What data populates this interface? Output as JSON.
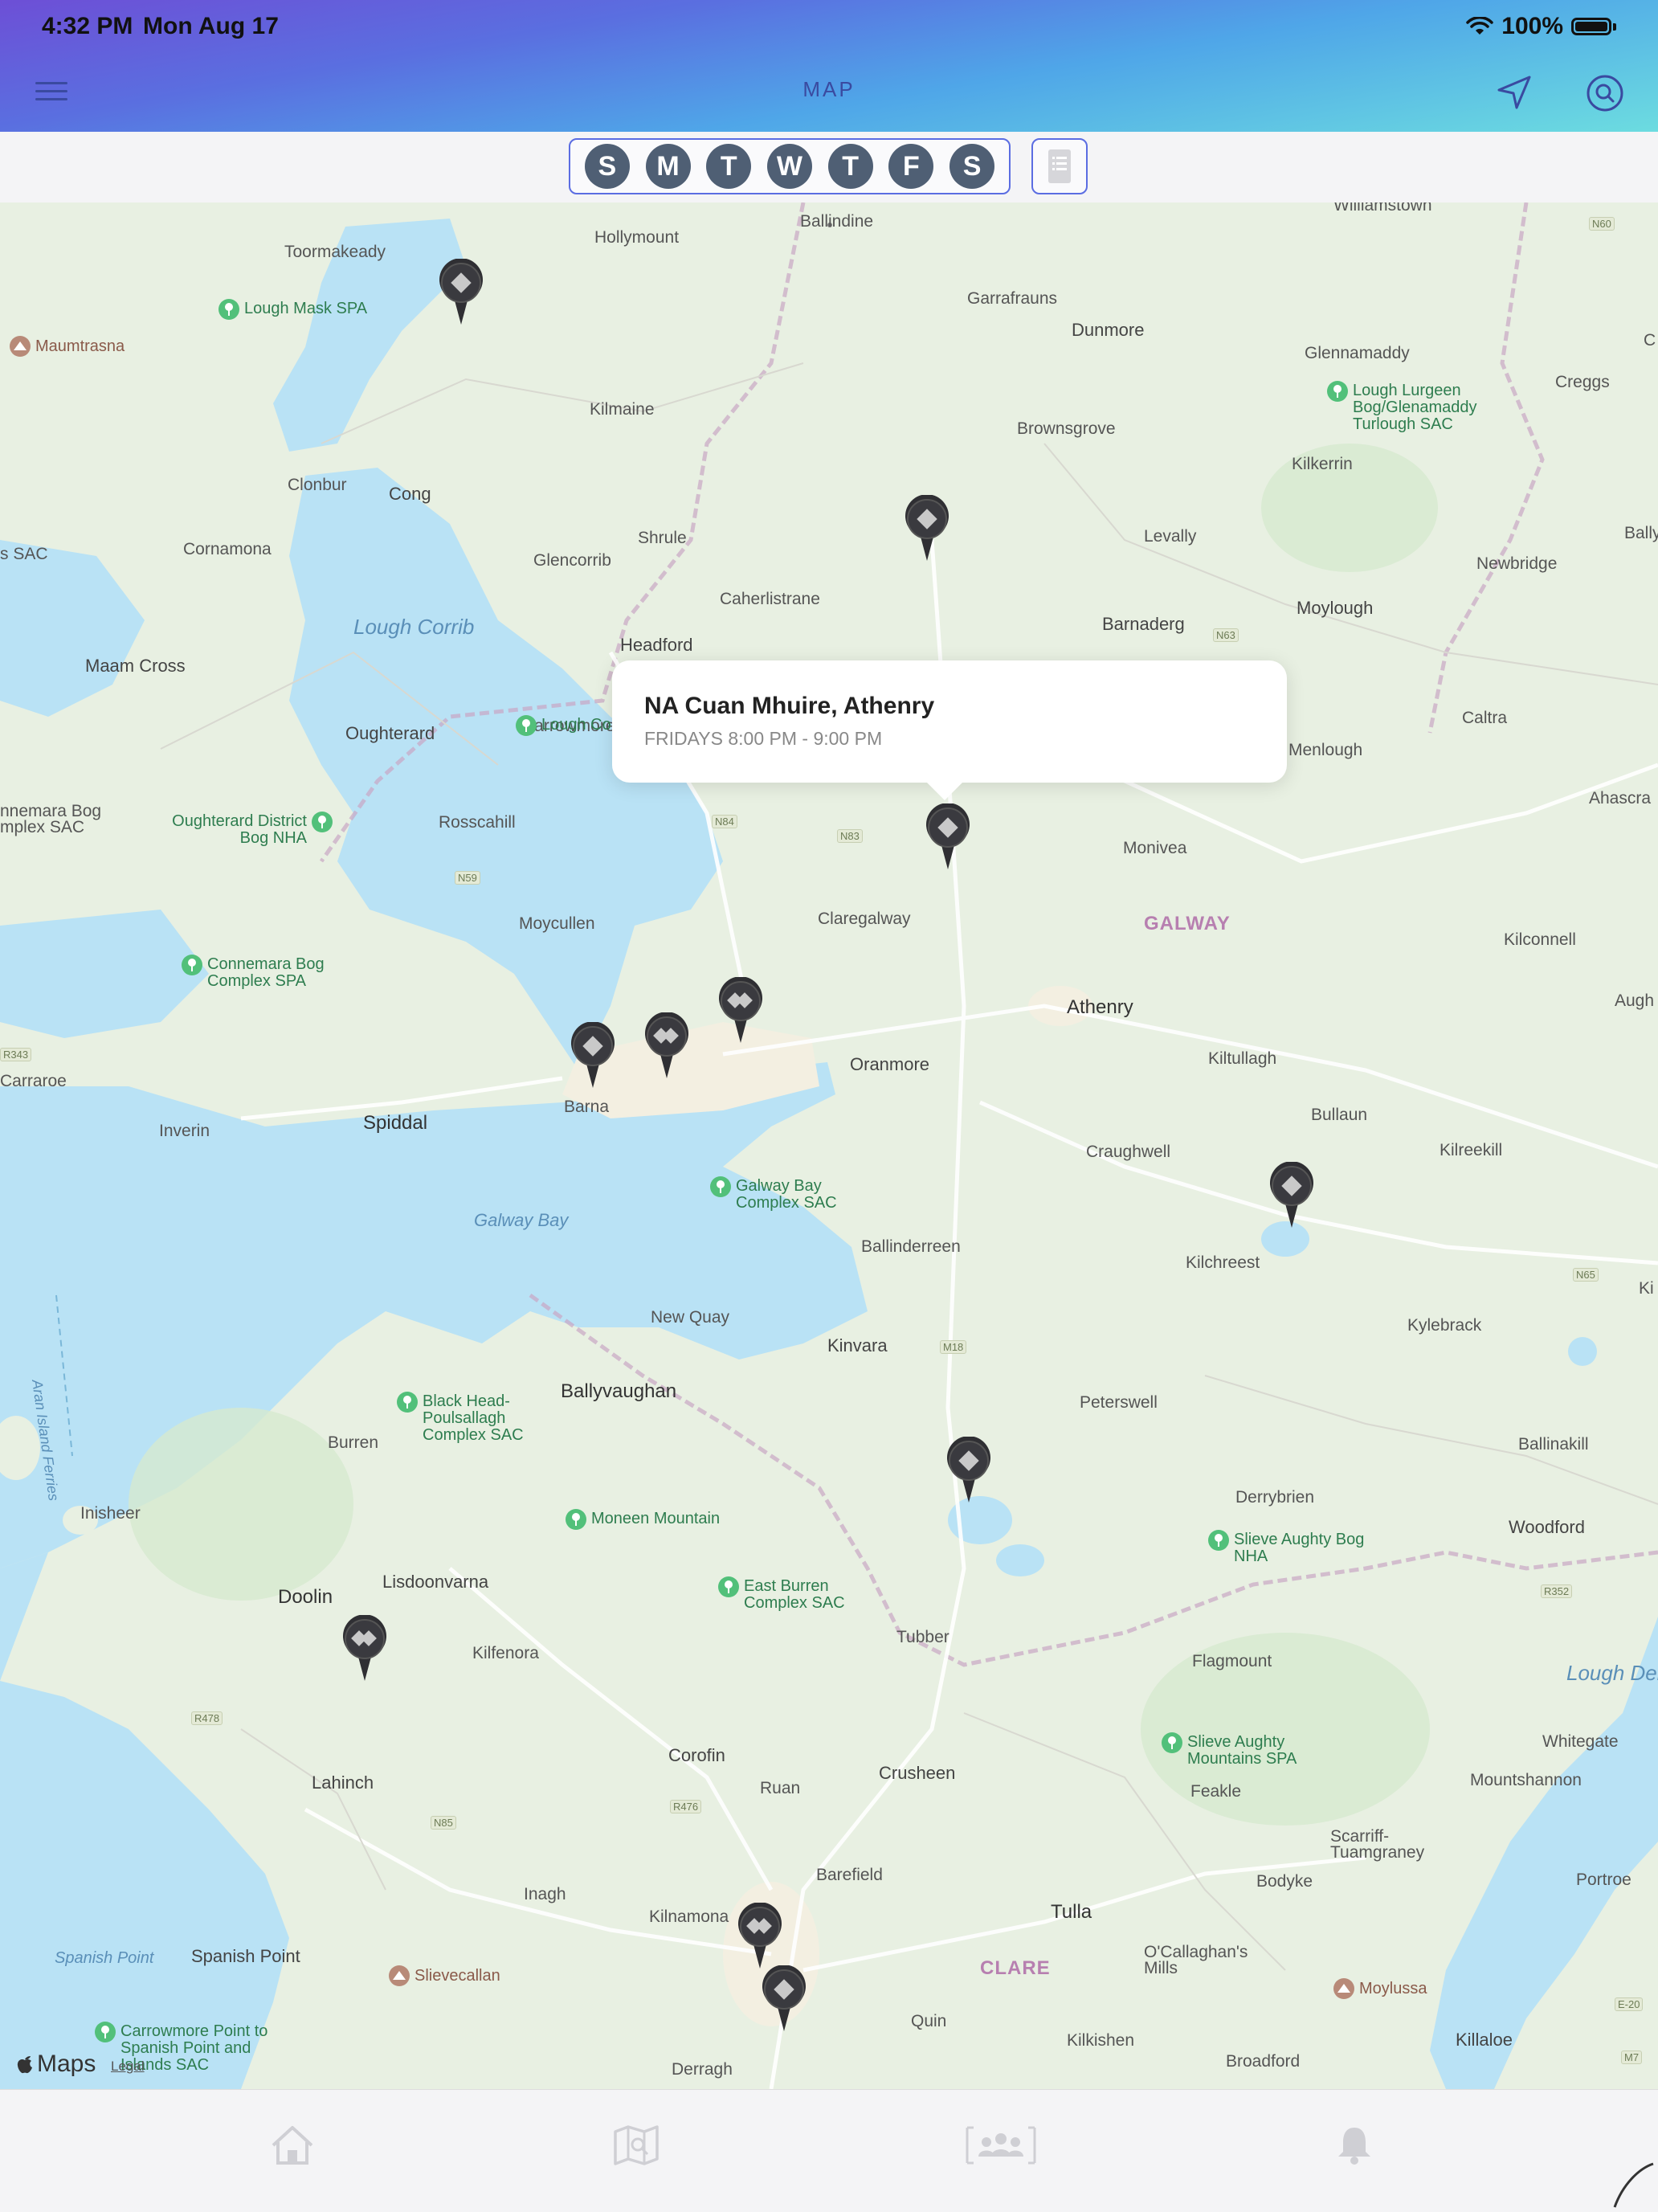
{
  "status_bar": {
    "time": "4:32 PM",
    "date": "Mon Aug 17",
    "battery": "100%"
  },
  "header": {
    "title": "MAP",
    "menu_icon": "hamburger-icon",
    "locate_icon": "location-arrow-icon",
    "search_icon": "search-icon"
  },
  "day_filter": {
    "days": [
      {
        "label": "S",
        "day": "Sunday"
      },
      {
        "label": "M",
        "day": "Monday"
      },
      {
        "label": "T",
        "day": "Tuesday"
      },
      {
        "label": "W",
        "day": "Wednesday"
      },
      {
        "label": "T",
        "day": "Thursday"
      },
      {
        "label": "F",
        "day": "Friday"
      },
      {
        "label": "S",
        "day": "Saturday"
      }
    ],
    "list_icon": "list-icon"
  },
  "callout": {
    "title": "NA Cuan Mhuire, Athenry",
    "subtitle": "FRIDAYS 8:00 PM - 9:00 PM"
  },
  "map_labels": {
    "ballindine": "Ballindine",
    "hollymount": "Hollymount",
    "toormakeady": "Toormakeady",
    "williamstown": "Williamstown",
    "garrafrauns": "Garrafrauns",
    "dunmore": "Dunmore",
    "glennamaddy": "Glennamaddy",
    "creggs": "Creggs",
    "kilmaine": "Kilmaine",
    "brownsgrove": "Brownsgrove",
    "kilkerrin": "Kilkerrin",
    "clonbur": "Clonbur",
    "cong": "Cong",
    "cornamona": "Cornamona",
    "shrule": "Shrule",
    "levally": "Levally",
    "ballygar": "Ballyga",
    "glencorrib": "Glencorrib",
    "newbridge": "Newbridge",
    "caherlistrane": "Caherlistrane",
    "barnaderg": "Barnaderg",
    "moylough": "Moylough",
    "lough_corrib": "Lough Corrib",
    "maam_cross": "Maam Cross",
    "headford": "Headford",
    "caltra": "Caltra",
    "oughterard": "Oughterard",
    "carrowmore": "Carrowmore",
    "menlough": "Menlough",
    "ahascragh": "Ahascra",
    "rosscahill": "Rosscahill",
    "monivea": "Monivea",
    "moycullen": "Moycullen",
    "claregalway": "Claregalway",
    "galway_county": "GALWAY",
    "kilconnell": "Kilconnell",
    "athenry": "Athenry",
    "aughrim": "Augh",
    "carraroe": "Carraroe",
    "kiltullagh": "Kiltullagh",
    "oranmore": "Oranmore",
    "barna": "Barna",
    "spiddal": "Spiddal",
    "inverin": "Inverin",
    "bullaun": "Bullaun",
    "craughwell": "Craughwell",
    "kilreekill": "Kilreekill",
    "galway_bay": "Galway Bay",
    "ballinderreen": "Ballinderreen",
    "kilchreest": "Kilchreest",
    "new_quay": "New Quay",
    "kinvara": "Kinvara",
    "kylebrack": "Kylebrack",
    "aran_ferries": "Aran Island Ferries",
    "ballyvaughan": "Ballyvaughan",
    "peterswell": "Peterswell",
    "burren": "Burren",
    "ballinakill": "Ballinakill",
    "inisheer": "Inisheer",
    "derrybrien": "Derrybrien",
    "woodford": "Woodford",
    "lisdoonvarna": "Lisdoonvarna",
    "doolin": "Doolin",
    "tubber": "Tubber",
    "flagmount": "Flagmount",
    "lough_derg": "Lough Derg",
    "kilfenora": "Kilfenora",
    "whitegate": "Whitegate",
    "corofin": "Corofin",
    "crusheen": "Crusheen",
    "lahinch": "Lahinch",
    "ruan": "Ruan",
    "feakle": "Feakle",
    "mountshannon": "Mountshannon",
    "scarriff": "Scarriff-Tuamgraney",
    "bodyke": "Bodyke",
    "portroe": "Portroe",
    "barefield": "Barefield",
    "inagh": "Inagh",
    "kilnamona": "Kilnamona",
    "tulla": "Tulla",
    "spanish_point_water": "Spanish Point",
    "spanish_point": "Spanish Point",
    "clare_county": "CLARE",
    "ocallaghans_mills": "O'Callaghan's Mills",
    "quin": "Quin",
    "kilkishen": "Kilkishen",
    "killaloe": "Killaloe",
    "derragh": "Derragh",
    "broadford": "Broadford",
    "sac_left": "s SAC",
    "connemara_left": "nnemara Bog mplex SAC",
    "kilx": "Ki",
    "cx": "C"
  },
  "parks": [
    {
      "name": "Lough Mask SPA"
    },
    {
      "name": "Lough Lurgeen Bog/Glenamaddy Turlough SAC"
    },
    {
      "name": "Lough Co"
    },
    {
      "name": "Oughterard District Bog NHA"
    },
    {
      "name": "Connemara Bog Complex SPA"
    },
    {
      "name": "Galway Bay Complex SAC"
    },
    {
      "name": "Black Head-Poulsallagh Complex SAC"
    },
    {
      "name": "Moneen Mountain"
    },
    {
      "name": "East Burren Complex SAC"
    },
    {
      "name": "Slieve Aughty Bog NHA"
    },
    {
      "name": "Slieve Aughty Mountains SPA"
    },
    {
      "name": "Carrowmore Point to Spanish Point and Islands SAC"
    }
  ],
  "mountains": [
    {
      "name": "Maumtrasna"
    },
    {
      "name": "Slievecallan"
    },
    {
      "name": "Moylussa"
    }
  ],
  "road_shields": [
    "N60",
    "N63",
    "N84",
    "N83",
    "N59",
    "R343",
    "N65",
    "M18",
    "R352",
    "R478",
    "N85",
    "R476",
    "E-20",
    "M7"
  ],
  "meeting_pins": [
    {
      "id": "pin-1",
      "type": "single"
    },
    {
      "id": "pin-2",
      "type": "single"
    },
    {
      "id": "pin-3",
      "type": "single",
      "selected": true
    },
    {
      "id": "pin-4",
      "type": "single"
    },
    {
      "id": "pin-5",
      "type": "double"
    },
    {
      "id": "pin-6",
      "type": "double"
    },
    {
      "id": "pin-7",
      "type": "single"
    },
    {
      "id": "pin-8",
      "type": "single"
    },
    {
      "id": "pin-9",
      "type": "double"
    },
    {
      "id": "pin-10",
      "type": "double"
    },
    {
      "id": "pin-11",
      "type": "single"
    }
  ],
  "attribution": {
    "logo": "Maps",
    "legal": "Legal"
  },
  "tab_bar": [
    {
      "name": "home",
      "icon": "home-icon"
    },
    {
      "name": "map",
      "icon": "map-icon"
    },
    {
      "name": "groups",
      "icon": "group-icon"
    },
    {
      "name": "notifications",
      "icon": "bell-icon"
    }
  ],
  "colors": {
    "header_start": "#6d4fd6",
    "header_end": "#6cdce0",
    "accent": "#5b6de2",
    "day_button": "#4f5f74",
    "water": "#b9e2f5",
    "land": "#e8f0e2",
    "park_text": "#2e7d4f"
  }
}
